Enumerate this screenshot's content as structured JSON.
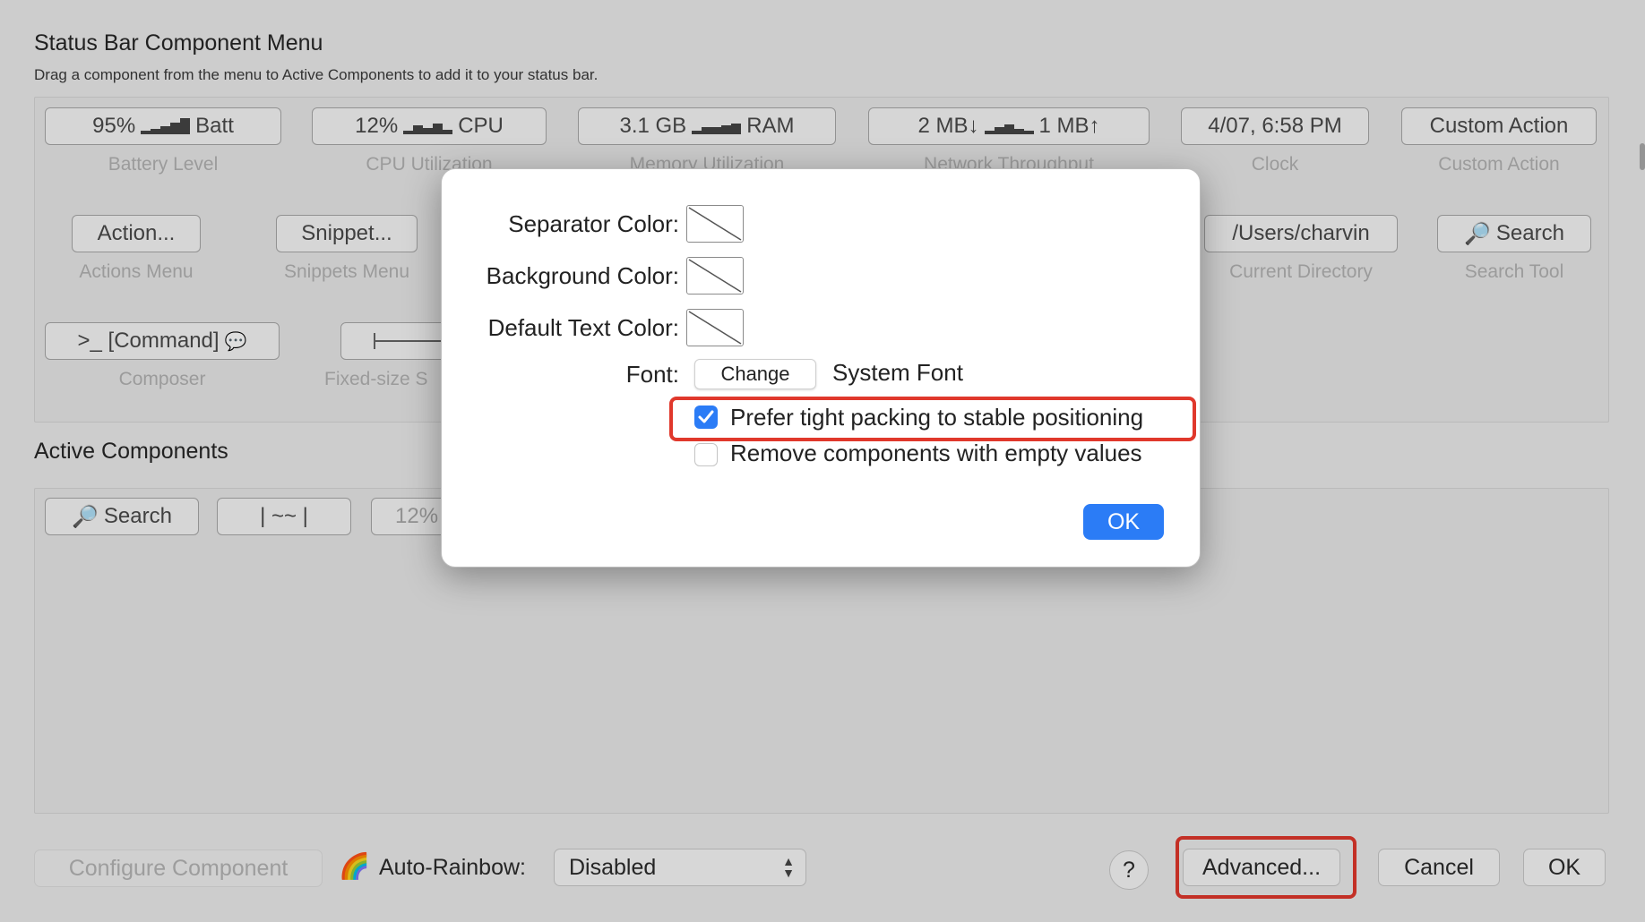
{
  "menu": {
    "title": "Status Bar Component Menu",
    "subtitle": "Drag a component from the menu to Active Components to add it to your status bar.",
    "row1": [
      {
        "button": "95%",
        "suffix": "Batt",
        "label": "Battery Level"
      },
      {
        "button": "12%",
        "suffix": "CPU",
        "label": "CPU Utilization"
      },
      {
        "button": "3.1 GB",
        "suffix": "RAM",
        "label": "Memory Utilization"
      },
      {
        "button": "2 MB↓",
        "suffix": "1 MB↑",
        "label": "Network Throughput"
      },
      {
        "button": "4/07, 6:58 PM",
        "label": "Clock"
      },
      {
        "button": "Custom Action",
        "label": "Custom Action"
      }
    ],
    "row2": [
      {
        "button": "Action...",
        "label": "Actions Menu"
      },
      {
        "button": "Snippet...",
        "label": "Snippets Menu"
      },
      {
        "button": "/Users/charvin",
        "label": "Current Directory"
      },
      {
        "button": "Search",
        "label": "Search Tool"
      }
    ],
    "row3": [
      {
        "button": ">_ [Command]",
        "label": "Composer"
      },
      {
        "button": "",
        "label": "Fixed-size S"
      }
    ]
  },
  "active": {
    "title": "Active Components",
    "items": [
      "Search",
      "| ~~ |",
      "12%"
    ]
  },
  "bottom": {
    "configure": "Configure Component",
    "rainbow_label": "Auto-Rainbow:",
    "rainbow_value": "Disabled",
    "help": "?",
    "advanced": "Advanced...",
    "cancel": "Cancel",
    "ok": "OK"
  },
  "dialog": {
    "separator_label": "Separator Color:",
    "background_label": "Background Color:",
    "text_label": "Default Text Color:",
    "font_label": "Font:",
    "change_button": "Change",
    "font_value": "System Font",
    "tight_packing": {
      "label": "Prefer tight packing to stable positioning",
      "checked": true
    },
    "remove_empty": {
      "label": "Remove components with empty values",
      "checked": false
    },
    "ok": "OK"
  },
  "colors": {
    "accent": "#2b7cf6",
    "highlight": "#e0382c"
  }
}
